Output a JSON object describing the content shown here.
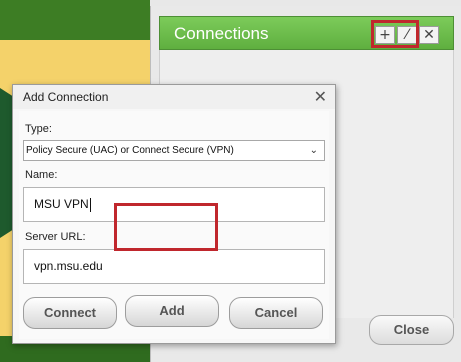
{
  "connections_panel": {
    "title": "Connections",
    "add_icon": "plus-icon",
    "edit_icon": "pencil-icon",
    "delete_icon": "x-icon",
    "status_fragment": "ons",
    "close_label": "Close"
  },
  "dialog": {
    "title": "Add Connection",
    "close_icon": "x-icon",
    "type_label": "Type:",
    "type_value": "Policy Secure (UAC) or Connect Secure (VPN)",
    "name_label": "Name:",
    "name_value": "MSU VPN",
    "server_label": "Server URL:",
    "server_value": "vpn.msu.edu",
    "connect_label": "Connect",
    "add_label": "Add",
    "cancel_label": "Cancel"
  },
  "colors": {
    "header_green": "#5faf3f",
    "highlight_red": "#c0272d",
    "background_yellow": "#f4d26a",
    "background_green": "#3d7d24"
  }
}
